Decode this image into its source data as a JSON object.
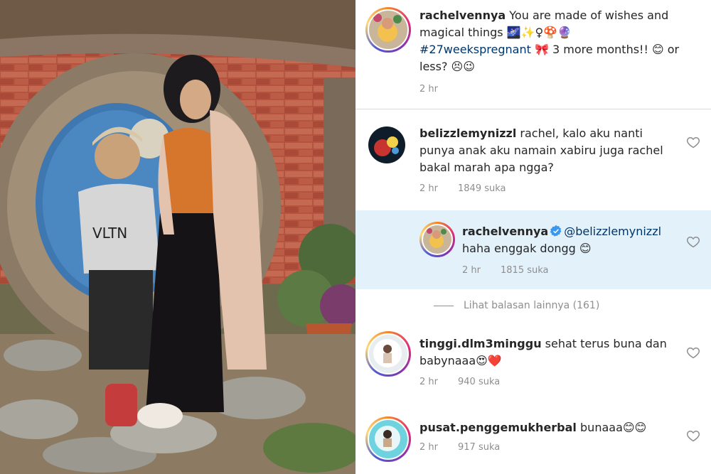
{
  "post": {
    "author": "rachelvennya",
    "caption_text": "You are made of wishes and",
    "caption_text2": "magical things 🌌✨♀🍄🔮",
    "hashtag": "#27weekspregnant",
    "caption_text3": "🎀 3 more months!! 😊 or",
    "caption_text4": "less? 😣😉",
    "time": "2 hr"
  },
  "comments": [
    {
      "username": "belizzlemynizzl",
      "line1": "rachel, kalo aku nanti",
      "line2": "punya anak aku namain xabiru juga rachel",
      "line3": "bakal marah apa ngga?",
      "time": "2 hr",
      "likes": "1849 suka"
    },
    {
      "username": "rachelvennya",
      "mention": "@belizzlemynizzl",
      "line2": "haha enggak dongg 😊",
      "time": "2 hr",
      "likes": "1815 suka"
    },
    {
      "username": "tinggi.dlm3minggu",
      "line1": "sehat terus buna dan",
      "line2": "babynaaa😍❤️",
      "time": "2 hr",
      "likes": "940 suka"
    },
    {
      "username": "pusat.penggemukherbal",
      "line1": "bunaaa😊😊",
      "time": "2 hr",
      "likes": "917 suka"
    }
  ],
  "view_more": "Lihat balasan lainnya (161)",
  "photo_text": {
    "sweater": "VLTN"
  },
  "colors": {
    "mention": "#003569",
    "reply_bg": "#e3f1fb",
    "verified": "#3897f0",
    "meta": "#8e8e8e"
  }
}
